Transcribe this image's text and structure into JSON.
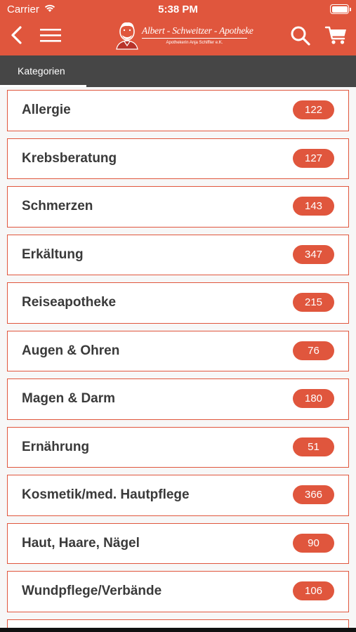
{
  "status_bar": {
    "carrier": "Carrier",
    "time": "5:38 PM"
  },
  "header": {
    "logo_title": "Albert - Schweitzer - Apotheke",
    "logo_subtitle": "Apothekerin Anja Schiffler e.K.",
    "icons": [
      "back-icon",
      "menu-icon",
      "search-icon",
      "cart-icon"
    ]
  },
  "tabs": [
    {
      "label": "Kategorien",
      "active": true
    }
  ],
  "categories": [
    {
      "label": "Allergie",
      "count": "122"
    },
    {
      "label": "Krebsberatung",
      "count": "127"
    },
    {
      "label": "Schmerzen",
      "count": "143"
    },
    {
      "label": "Erkältung",
      "count": "347"
    },
    {
      "label": "Reiseapotheke",
      "count": "215"
    },
    {
      "label": "Augen & Ohren",
      "count": "76"
    },
    {
      "label": "Magen & Darm",
      "count": "180"
    },
    {
      "label": "Ernährung",
      "count": "51"
    },
    {
      "label": "Kosmetik/med. Hautpflege",
      "count": "366"
    },
    {
      "label": "Haut, Haare, Nägel",
      "count": "90"
    },
    {
      "label": "Wundpflege/Verbände",
      "count": "106"
    }
  ],
  "colors": {
    "accent": "#e0563d",
    "tabbar": "#464646",
    "text": "#3a3a3a",
    "background": "#f7f7f7"
  }
}
